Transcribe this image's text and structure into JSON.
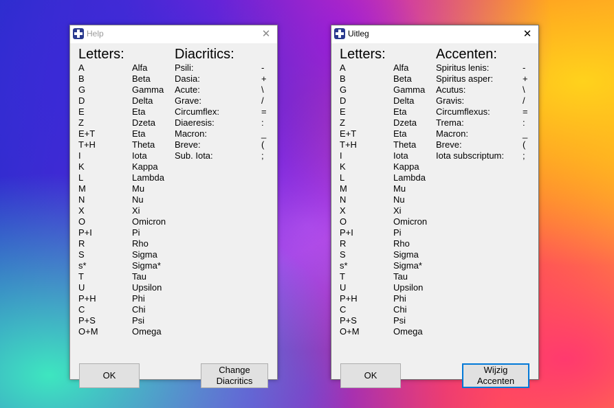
{
  "help": {
    "title": "Help",
    "letters_heading": "Letters:",
    "diacritics_heading": "Diacritics:",
    "letter_keys": [
      "A",
      "B",
      "G",
      "D",
      "E",
      "Z",
      "E+T",
      "T+H",
      "I",
      "K",
      "L",
      "M",
      "N",
      "X",
      "O",
      "P+I",
      "R",
      "S",
      "s*",
      "T",
      "U",
      "P+H",
      "C",
      "P+S",
      "O+M"
    ],
    "letter_names": [
      "Alfa",
      "Beta",
      "Gamma",
      "Delta",
      "Eta",
      "Dzeta",
      "Eta",
      "Theta",
      "Iota",
      "Kappa",
      "Lambda",
      "Mu",
      "Nu",
      "Xi",
      "Omicron",
      "Pi",
      "Rho",
      "Sigma",
      "Sigma*",
      "Tau",
      "Upsilon",
      "Phi",
      "Chi",
      "Psi",
      "Omega"
    ],
    "diacritic_names": [
      "Psili:",
      "Dasia:",
      "Acute:",
      "Grave:",
      "Circumflex:",
      "Diaeresis:",
      "Macron:",
      "Breve:",
      "Sub. Iota:"
    ],
    "diacritic_keys": [
      "-",
      "+",
      "\\",
      "/",
      "=",
      ":",
      "_",
      "(",
      ";"
    ],
    "ok_label": "OK",
    "change_label": "Change\nDiacritics"
  },
  "uitleg": {
    "title": "Uitleg",
    "letters_heading": "Letters:",
    "accents_heading": "Accenten:",
    "letter_keys": [
      "A",
      "B",
      "G",
      "D",
      "E",
      "Z",
      "E+T",
      "T+H",
      "I",
      "K",
      "L",
      "M",
      "N",
      "X",
      "O",
      "P+I",
      "R",
      "S",
      "s*",
      "T",
      "U",
      "P+H",
      "C",
      "P+S",
      "O+M"
    ],
    "letter_names": [
      "Alfa",
      "Beta",
      "Gamma",
      "Delta",
      "Eta",
      "Dzeta",
      "Eta",
      "Theta",
      "Iota",
      "Kappa",
      "Lambda",
      "Mu",
      "Nu",
      "Xi",
      "Omicron",
      "Pi",
      "Rho",
      "Sigma",
      "Sigma*",
      "Tau",
      "Upsilon",
      "Phi",
      "Chi",
      "Psi",
      "Omega"
    ],
    "accent_names": [
      "Spiritus lenis:",
      "Spiritus asper:",
      "Acutus:",
      "Gravis:",
      "Circumflexus:",
      "Trema:",
      "Macron:",
      "Breve:",
      "Iota subscriptum:"
    ],
    "accent_keys": [
      "-",
      "+",
      "\\",
      "/",
      "=",
      ":",
      "_",
      "(",
      ";"
    ],
    "ok_label": "OK",
    "change_label": "Wijzig\nAccenten"
  },
  "icons": {
    "window_icon": "greek-flag-icon",
    "close": "close-icon",
    "close_glyph": "✕"
  }
}
